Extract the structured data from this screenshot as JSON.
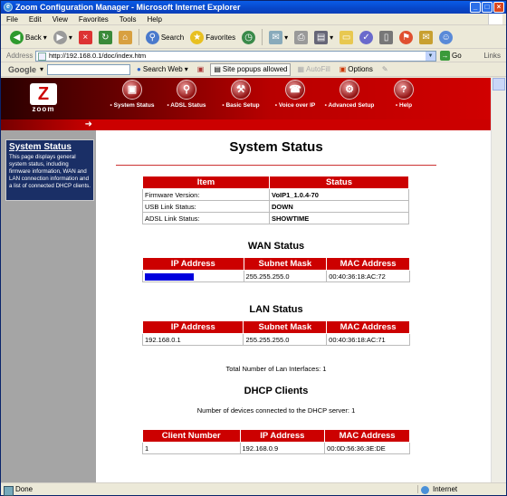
{
  "window": {
    "title": "Zoom Configuration Manager - Microsoft Internet Explorer"
  },
  "menu": [
    "File",
    "Edit",
    "View",
    "Favorites",
    "Tools",
    "Help"
  ],
  "toolbar": {
    "back": "Back",
    "search": "Search",
    "favorites": "Favorites"
  },
  "address": {
    "label": "Address",
    "url": "http://192.168.0.1/doc/index.htm",
    "go": "Go",
    "links": "Links"
  },
  "google": {
    "logo": "Google",
    "search_web": "Search Web",
    "popups": "Site popups allowed",
    "autofill": "AutoFill",
    "options": "Options"
  },
  "brand": {
    "logo_text": "zoom",
    "arrow": "➜"
  },
  "nav": [
    "System Status",
    "ADSL Status",
    "Basic Setup",
    "Voice over IP",
    "Advanced Setup",
    "Help"
  ],
  "sidebar": {
    "title": "System Status",
    "description": "This page displays general system status, including firmware information, WAN and LAN connection information and a list of connected DHCP clients."
  },
  "page": {
    "title": "System Status"
  },
  "system_table": {
    "headers": [
      "Item",
      "Status"
    ],
    "rows": [
      [
        "Firmware Version:",
        "VoIP1_1.0.4-70"
      ],
      [
        "USB Link Status:",
        "DOWN"
      ],
      [
        "ADSL Link Status:",
        "SHOWTIME"
      ]
    ]
  },
  "wan": {
    "title": "WAN Status",
    "headers": [
      "IP Address",
      "Subnet Mask",
      "MAC Address"
    ],
    "row": [
      "",
      "255.255.255.0",
      "00:40:36:18:AC:72"
    ]
  },
  "lan": {
    "title": "LAN Status",
    "headers": [
      "IP Address",
      "Subnet Mask",
      "MAC Address"
    ],
    "row": [
      "192.168.0.1",
      "255.255.255.0",
      "00:40:36:18:AC:71"
    ],
    "note": "Total Number of Lan Interfaces: 1"
  },
  "dhcp": {
    "title": "DHCP Clients",
    "note": "Number of devices connected to the DHCP server: 1",
    "headers": [
      "Client Number",
      "IP Address",
      "MAC Address"
    ],
    "row": [
      "1",
      "192.168.0.9",
      "00:0D:56:36:3E:DE"
    ]
  },
  "status": {
    "left": "Done",
    "zone": "Internet"
  },
  "colors": {
    "accent": "#cc0000",
    "sidebar_box": "#1a2f66",
    "wan_ip_redacted": "#0000dd"
  }
}
